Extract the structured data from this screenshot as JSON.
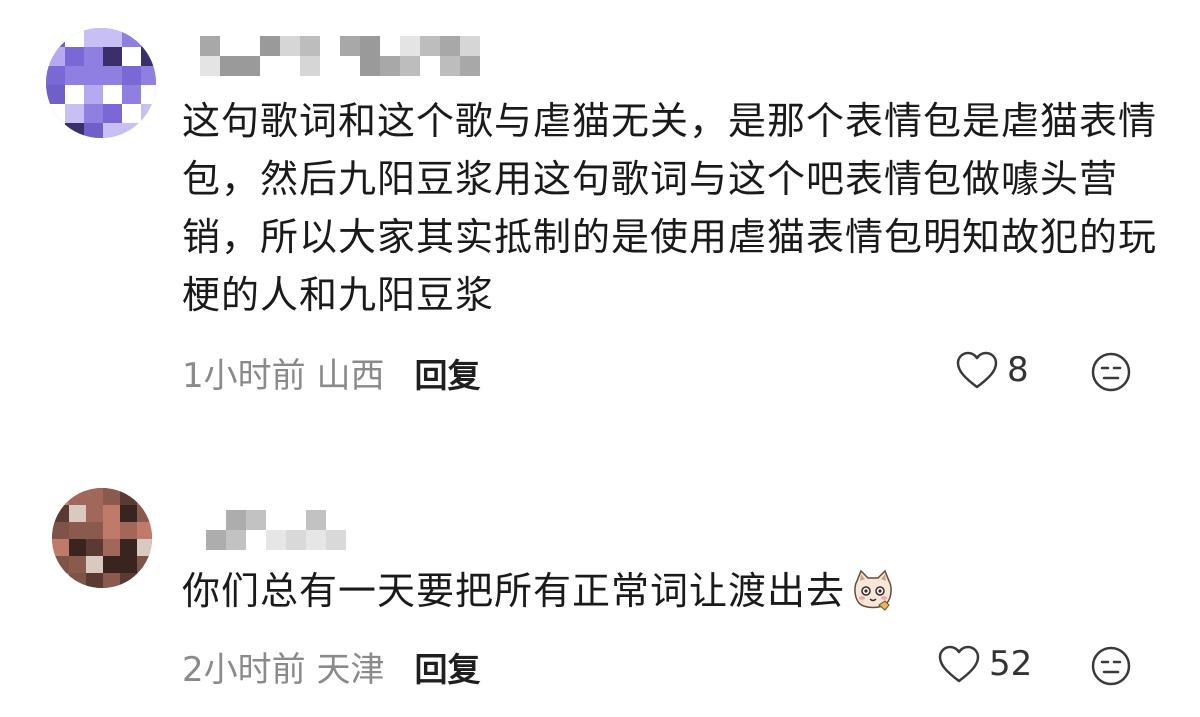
{
  "comments": [
    {
      "text": "这句歌词和这个歌与虐猫无关，是那个表情包是虐猫表情包，然后九阳豆浆用这句歌词与这个吧表情包做噱头营销，所以大家其实抵制的是使用虐猫表情包明知故犯的玩梗的人和九阳豆浆",
      "time_location": "1小时前 山西",
      "reply_label": "回复",
      "likes": "8",
      "avatar_color": "#a89ae8",
      "icons": [
        "heart-outline-icon",
        "dislike-face-icon"
      ]
    },
    {
      "text": "你们总有一天要把所有正常词让渡出去",
      "time_location": "2小时前 天津",
      "reply_label": "回复",
      "likes": "52",
      "avatar_color": "#6b4a40",
      "icons": [
        "cat-emoji-icon",
        "heart-outline-icon",
        "dislike-face-icon"
      ]
    }
  ]
}
